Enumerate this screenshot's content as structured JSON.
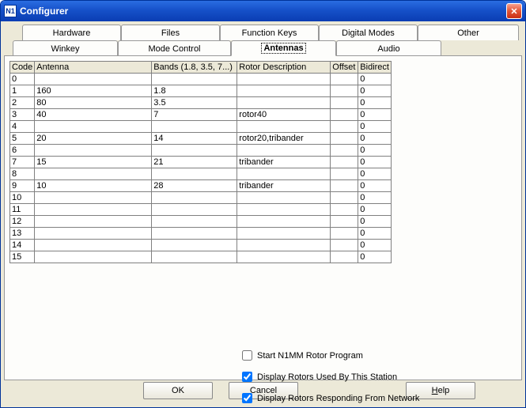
{
  "window": {
    "title": "Configurer"
  },
  "tabs_row1": {
    "hardware": "Hardware",
    "files": "Files",
    "fkeys": "Function Keys",
    "digital": "Digital Modes",
    "other": "Other"
  },
  "tabs_row2": {
    "winkey": "Winkey",
    "mode": "Mode Control",
    "antennas": "Antennas",
    "audio": "Audio"
  },
  "table": {
    "headers": {
      "code": "Code",
      "antenna": "Antenna",
      "bands": "Bands (1.8, 3.5, 7...)",
      "rotor": "Rotor Description",
      "offset": "Offset",
      "bidirect": "Bidirect"
    },
    "rows": [
      {
        "code": "0",
        "antenna": "",
        "bands": "",
        "rotor": "",
        "offset": "",
        "bidirect": "0"
      },
      {
        "code": "1",
        "antenna": "160",
        "bands": "1.8",
        "rotor": "",
        "offset": "",
        "bidirect": "0"
      },
      {
        "code": "2",
        "antenna": "80",
        "bands": "3.5",
        "rotor": "",
        "offset": "",
        "bidirect": "0"
      },
      {
        "code": "3",
        "antenna": "40",
        "bands": "7",
        "rotor": "rotor40",
        "offset": "",
        "bidirect": "0"
      },
      {
        "code": "4",
        "antenna": "",
        "bands": "",
        "rotor": "",
        "offset": "",
        "bidirect": "0"
      },
      {
        "code": "5",
        "antenna": "20",
        "bands": "14",
        "rotor": "rotor20,tribander",
        "offset": "",
        "bidirect": "0"
      },
      {
        "code": "6",
        "antenna": "",
        "bands": "",
        "rotor": "",
        "offset": "",
        "bidirect": "0"
      },
      {
        "code": "7",
        "antenna": "15",
        "bands": "21",
        "rotor": "tribander",
        "offset": "",
        "bidirect": "0"
      },
      {
        "code": "8",
        "antenna": "",
        "bands": "",
        "rotor": "",
        "offset": "",
        "bidirect": "0"
      },
      {
        "code": "9",
        "antenna": "10",
        "bands": "28",
        "rotor": "tribander",
        "offset": "",
        "bidirect": "0"
      },
      {
        "code": "10",
        "antenna": "",
        "bands": "",
        "rotor": "",
        "offset": "",
        "bidirect": "0"
      },
      {
        "code": "11",
        "antenna": "",
        "bands": "",
        "rotor": "",
        "offset": "",
        "bidirect": "0"
      },
      {
        "code": "12",
        "antenna": "",
        "bands": "",
        "rotor": "",
        "offset": "",
        "bidirect": "0"
      },
      {
        "code": "13",
        "antenna": "",
        "bands": "",
        "rotor": "",
        "offset": "",
        "bidirect": "0"
      },
      {
        "code": "14",
        "antenna": "",
        "bands": "",
        "rotor": "",
        "offset": "",
        "bidirect": "0"
      },
      {
        "code": "15",
        "antenna": "",
        "bands": "",
        "rotor": "",
        "offset": "",
        "bidirect": "0"
      }
    ]
  },
  "checks": {
    "start_rotor": {
      "label": "Start N1MM Rotor Program",
      "checked": false
    },
    "display_used": {
      "label": "Display Rotors Used By This Station",
      "checked": true
    },
    "display_net": {
      "label": "Display Rotors Responding From Network",
      "checked": true
    }
  },
  "buttons": {
    "ok": "OK",
    "cancel": "Cancel",
    "help": "Help"
  }
}
